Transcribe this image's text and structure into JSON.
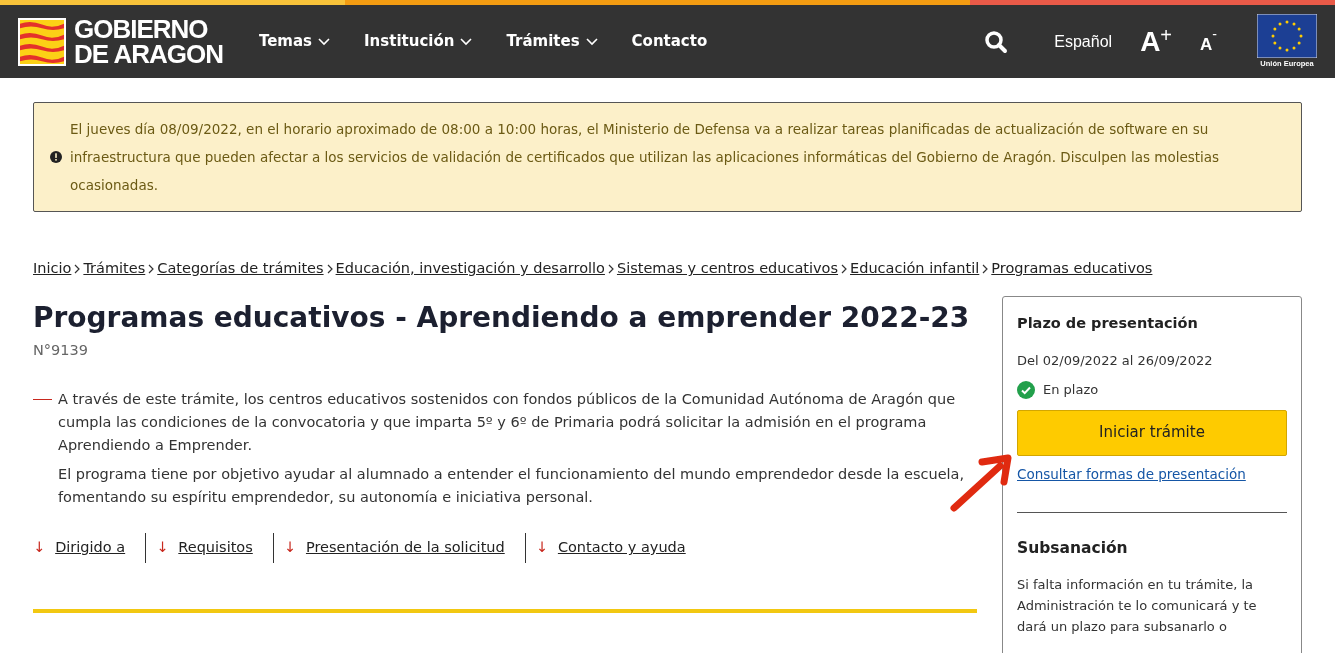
{
  "header": {
    "logo_line_1": "GOBIERNO",
    "logo_line_2": "DE ARAGON",
    "menu": [
      {
        "label": "Temas",
        "dropdown": true
      },
      {
        "label": "Institución",
        "dropdown": true
      },
      {
        "label": "Trámites",
        "dropdown": true
      },
      {
        "label": "Contacto",
        "dropdown": false
      }
    ],
    "language": "Español",
    "font_increase": "A",
    "font_increase_sign": "+",
    "font_decrease": "A",
    "font_decrease_sign": "-",
    "eu_label": "Unión Europea"
  },
  "alert": {
    "text": "El jueves día 08/09/2022, en el horario aproximado de 08:00 a 10:00 horas, el Ministerio de Defensa va a realizar tareas planificadas de actualización de software en su infraestructura que pueden afectar a los servicios de validación de certificados que utilizan las aplicaciones informáticas del Gobierno de Aragón. Disculpen las molestias ocasionadas."
  },
  "breadcrumb": [
    "Inicio",
    "Trámites",
    "Categorías de trámites",
    "Educación, investigación y desarrollo",
    "Sistemas y centros educativos",
    "Educación infantil",
    "Programas educativos"
  ],
  "title": "Programas educativos - Aprendiendo a emprender 2022-23",
  "number": "N°9139",
  "description": [
    "A través de este trámite, los centros educativos sostenidos con fondos públicos de la Comunidad Autónoma de Aragón que cumpla las condiciones de la convocatoria y que imparta 5º y 6º de Primaria podrá solicitar la admisión en el programa Aprendiendo a Emprender.",
    "El programa tiene por objetivo ayudar al alumnado a entender el funcionamiento del mundo emprendedor desde la escuela, fomentando su espíritu emprendedor, su autonomía e iniciativa personal."
  ],
  "anchors": [
    {
      "arrow": "↓",
      "label": "Dirigido a"
    },
    {
      "arrow": "↓",
      "label": "Requisitos"
    },
    {
      "arrow": "↓",
      "label": "Presentación de la solicitud"
    },
    {
      "arrow": "↓",
      "label": "Contacto y ayuda"
    }
  ],
  "sidebar": {
    "heading": "Plazo de presentación",
    "dates": "Del 02/09/2022 al 26/09/2022",
    "status": "En plazo",
    "open": true,
    "button": "Iniciar trámite",
    "link": "Consultar formas de presentación",
    "heading_2": "Subsanación",
    "text_2": "Si falta información en tu trámite, la Administración te lo comunicará y te dará un plazo para subsanarlo o"
  }
}
